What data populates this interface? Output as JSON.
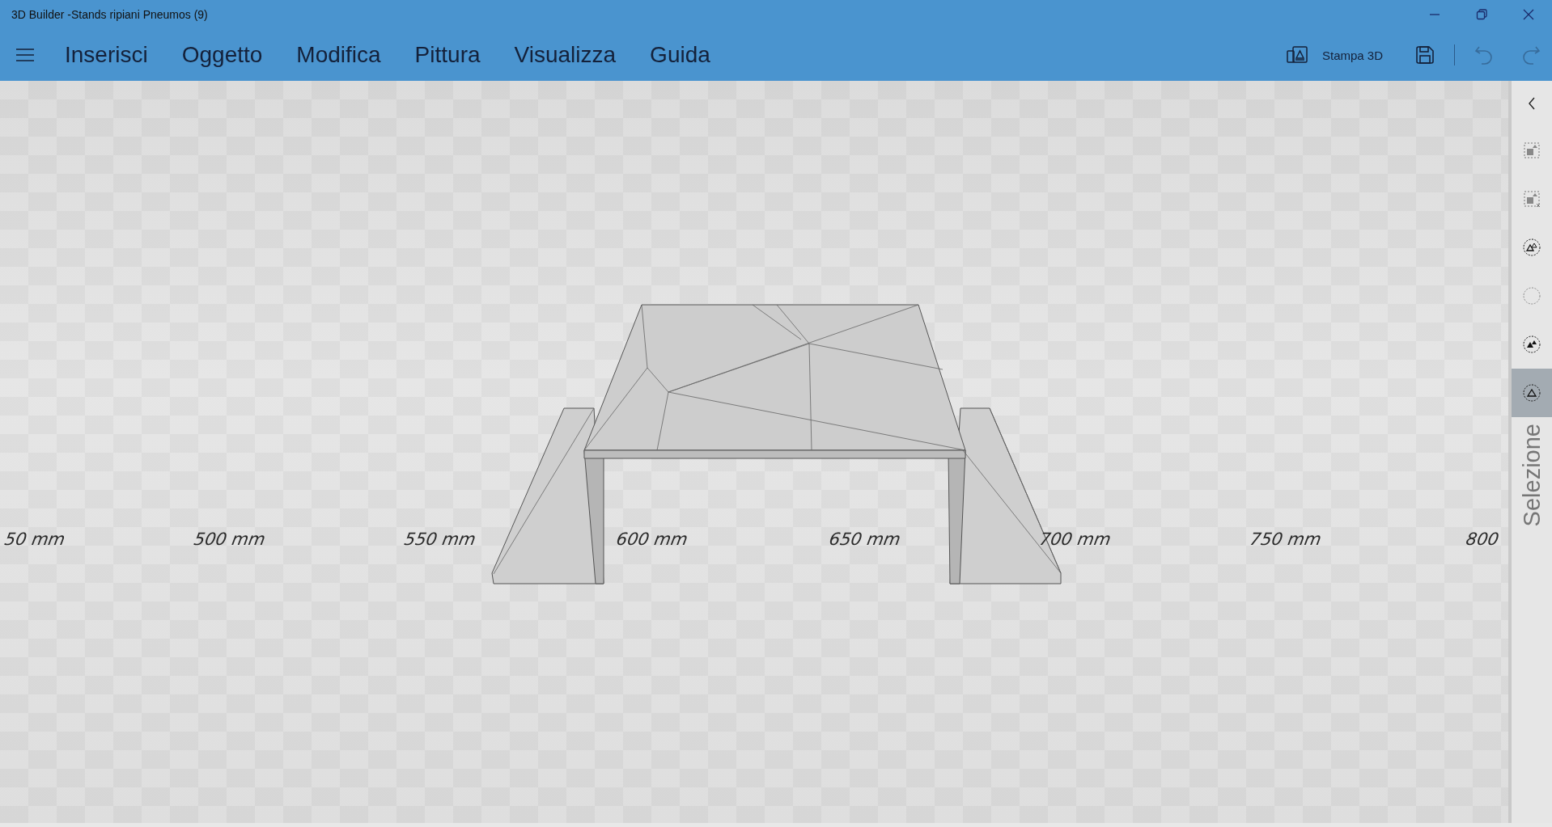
{
  "window": {
    "title": "3D Builder -Stands ripiani Pneumos (9)"
  },
  "menu": {
    "items": [
      {
        "label": "Inserisci"
      },
      {
        "label": "Oggetto"
      },
      {
        "label": "Modifica"
      },
      {
        "label": "Pittura"
      },
      {
        "label": "Visualizza"
      },
      {
        "label": "Guida"
      }
    ]
  },
  "toolbar": {
    "print_label": "Stampa 3D",
    "undo": {
      "disabled": true
    },
    "redo": {
      "disabled": true
    }
  },
  "viewport": {
    "ruler_labels": [
      "50 mm",
      "500 mm",
      "550 mm",
      "600 mm",
      "650 mm",
      "700 mm",
      "750 mm",
      "800"
    ]
  },
  "sidebar": {
    "tools": [
      {
        "kind": "box",
        "selected": false
      },
      {
        "kind": "boxclear",
        "selected": false
      },
      {
        "kind": "ringmount",
        "selected": false
      },
      {
        "kind": "ring",
        "selected": false
      },
      {
        "kind": "ringfill",
        "selected": false
      },
      {
        "kind": "ringtriangle",
        "selected": true
      }
    ],
    "label": "Selezione"
  }
}
